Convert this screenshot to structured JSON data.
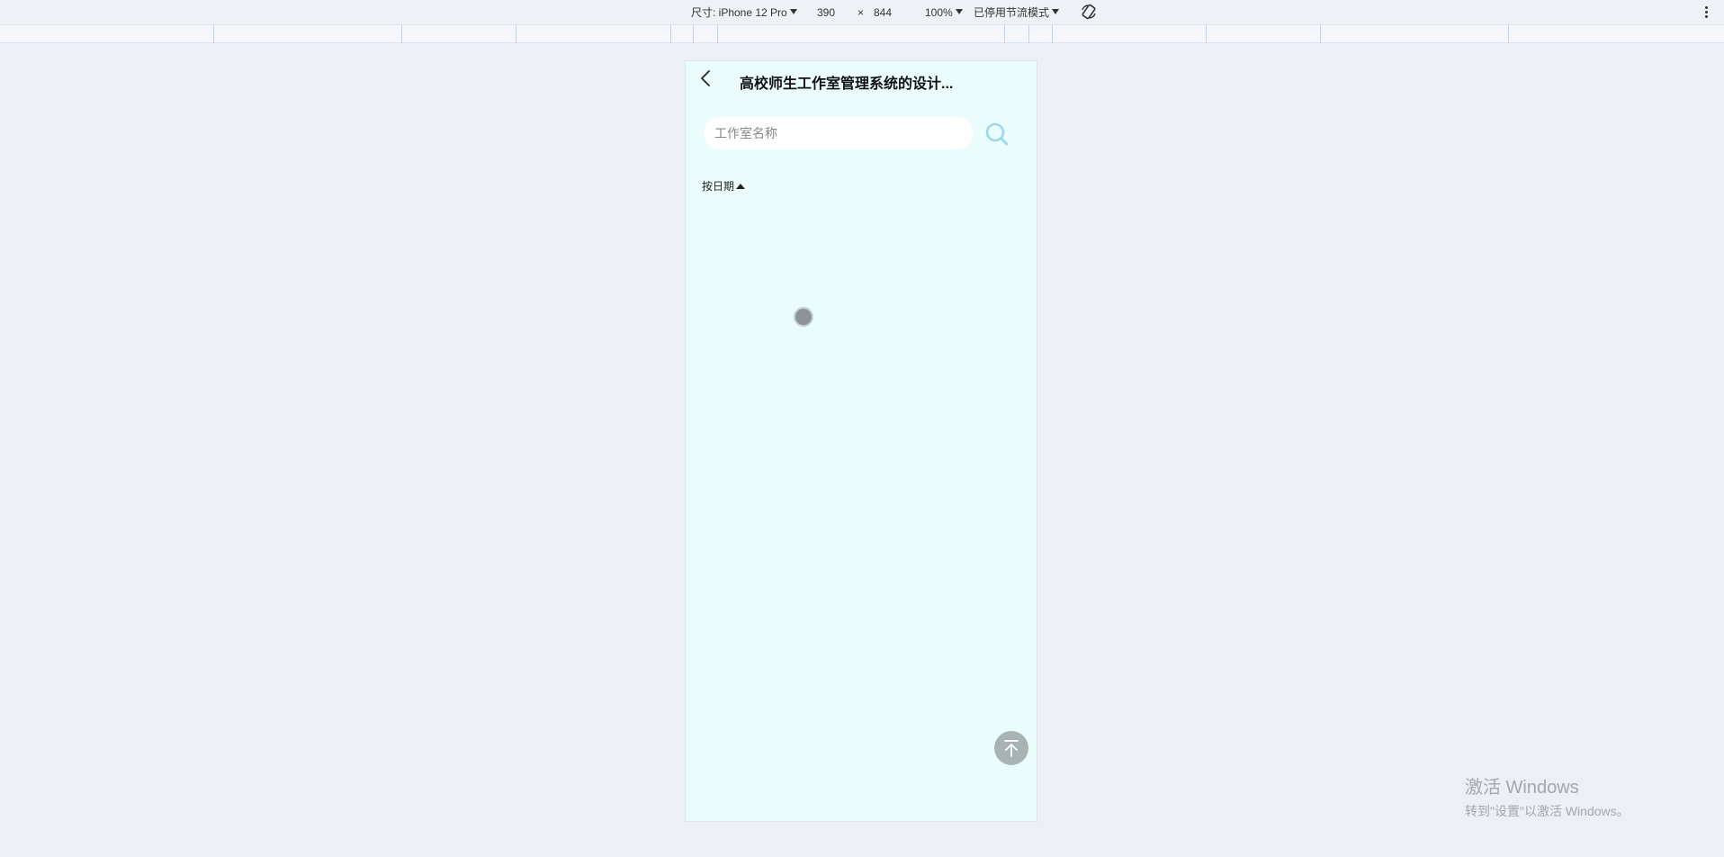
{
  "devtools": {
    "device_label": "尺寸: iPhone 12 Pro",
    "width": "390",
    "times": "×",
    "height": "844",
    "zoom": "100%",
    "throttle": "已停用节流模式"
  },
  "header": {
    "title": "高校师生工作室管理系统的设计..."
  },
  "search": {
    "placeholder": "工作室名称",
    "value": ""
  },
  "sort": {
    "label": "按日期"
  },
  "watermark": {
    "line1": "激活 Windows",
    "line2": "转到\"设置\"以激活 Windows。"
  },
  "icons": {
    "back": "chevron-left-icon",
    "search": "search-icon",
    "top": "back-to-top-icon",
    "rotate": "rotate-icon"
  }
}
